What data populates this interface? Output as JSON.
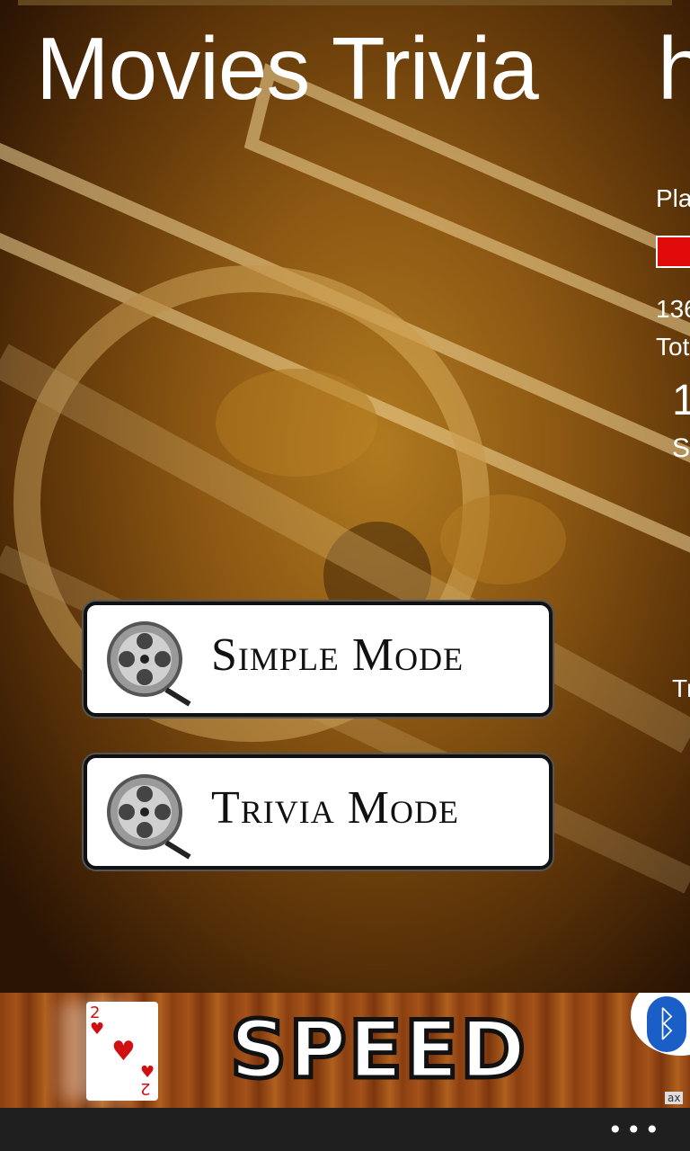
{
  "app": {
    "title": "Movies Trivia",
    "next_panel_title_fragment": "h"
  },
  "side_panel": {
    "line1": "Pla",
    "line2": "136",
    "line3": "Tot",
    "line4": "1",
    "line5": "S",
    "line6": "Tr"
  },
  "modes": [
    {
      "label": "Simple Mode"
    },
    {
      "label": "Trivia Mode"
    }
  ],
  "ad": {
    "title": "SPEED",
    "badge": "ax",
    "card_rank": "2"
  },
  "appbar": {
    "more": "•••"
  },
  "colors": {
    "progress": "#e10b0b",
    "accent_blue": "#1a5fc8"
  }
}
